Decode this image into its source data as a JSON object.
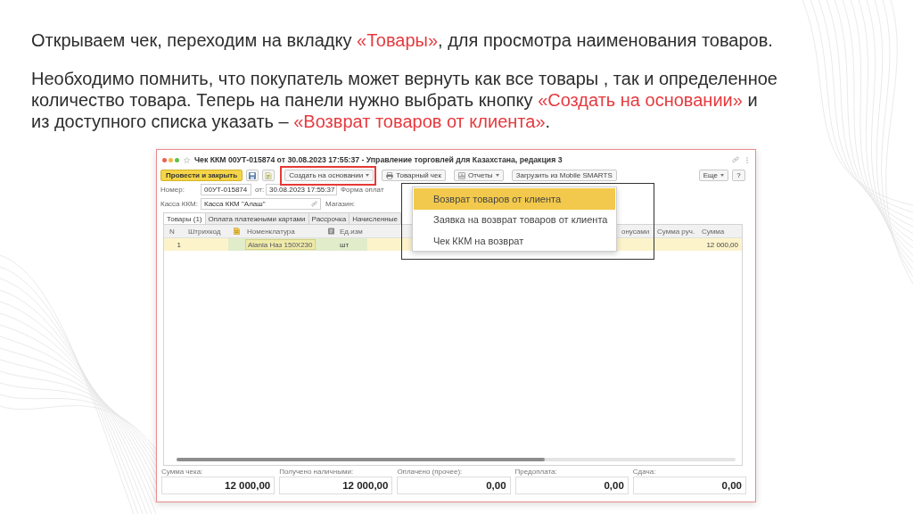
{
  "heading": [
    {
      "text": "Открываем чек, переходим на вкладку ",
      "accent": false
    },
    {
      "text": "«Товары»",
      "accent": true
    },
    {
      "text": ", для просмотра наименования товаров.",
      "accent": false
    }
  ],
  "note": [
    {
      "text": "Необходимо помнить, что покупатель может вернуть как все товары , так и определенное\nколичество товара. Теперь на панели нужно выбрать кнопку ",
      "accent": false
    },
    {
      "text": "«Создать на основании»",
      "accent": true
    },
    {
      "text": " и\nиз доступного списка указать – ",
      "accent": false
    },
    {
      "text": "«Возврат товаров от клиента»",
      "accent": true
    },
    {
      "text": ".",
      "accent": false
    }
  ],
  "window": {
    "title": "Чек ККМ 00УТ-015874 от 30.08.2023 17:55:37 - Управление торговлей для Казахстана, редакция 3",
    "toolbar": {
      "post_button": "Провести и закрыть",
      "buttons": [
        {
          "kind": "plain",
          "label": "Создать на основании",
          "dropdown": true,
          "highlighted": true
        },
        {
          "kind": "print",
          "label": "Товарный чек",
          "dropdown": false,
          "highlighted": false
        },
        {
          "kind": "reports",
          "label": "Отчеты",
          "dropdown": true,
          "highlighted": false
        },
        {
          "kind": "plain",
          "label": "Загрузить из Mobile SMARTS",
          "dropdown": false,
          "highlighted": false
        }
      ],
      "more_button": {
        "label": "Еще",
        "dropdown": true
      },
      "help_button": "?"
    },
    "fields": [
      [
        {
          "label": "Номер:",
          "value": "00УТ-015874"
        },
        {
          "label": "от:",
          "value": "30.08.2023 17:55:37"
        },
        {
          "label": "Форма оплат"
        }
      ],
      [
        {
          "label": "Касса ККМ:",
          "value": "Касса ККМ \"Алаш\"",
          "link": true
        },
        {
          "label": "Магазин:"
        }
      ]
    ],
    "tabs": [
      {
        "label": "Товары (1)",
        "selected": true
      },
      {
        "label": "Оплата платежными картами",
        "selected": false
      },
      {
        "label": "Рассрочка",
        "selected": false
      },
      {
        "label": "Начисленные",
        "selected": false
      }
    ],
    "table": {
      "columns": [
        {
          "kind": "text",
          "label": "N"
        },
        {
          "kind": "text",
          "label": "Штрихкод"
        },
        {
          "kind": "series"
        },
        {
          "kind": "text",
          "label": "Номенклатура"
        },
        {
          "kind": "unit"
        },
        {
          "kind": "text",
          "label": "Ед.изм"
        },
        {
          "kind": "text",
          "label": "онусами"
        },
        {
          "kind": "text",
          "label": "Сумма руч."
        },
        {
          "kind": "text",
          "label": "Сумма"
        }
      ],
      "rows": [
        {
          "selected": true,
          "number": "1",
          "item": "Alania Наз 150X230",
          "unit": "шт",
          "sum": "12 000,00"
        }
      ]
    },
    "totals": [
      {
        "label": "Сумма чека:",
        "value": "12 000,00"
      },
      {
        "label": "Получено наличными:",
        "value": "12 000,00"
      },
      {
        "label": "Оплачено (прочее):",
        "value": "0,00"
      },
      {
        "label": "Предоплата:",
        "value": "0,00"
      },
      {
        "label": "Сдача:",
        "value": "0,00"
      }
    ],
    "menu": {
      "outlined": true,
      "items": [
        {
          "label": "Возврат товаров от клиента",
          "selected": true
        },
        {
          "label": "Заявка на возврат товаров от клиента",
          "selected": false
        },
        {
          "label": "Чек ККМ на возврат",
          "selected": false
        }
      ]
    }
  }
}
